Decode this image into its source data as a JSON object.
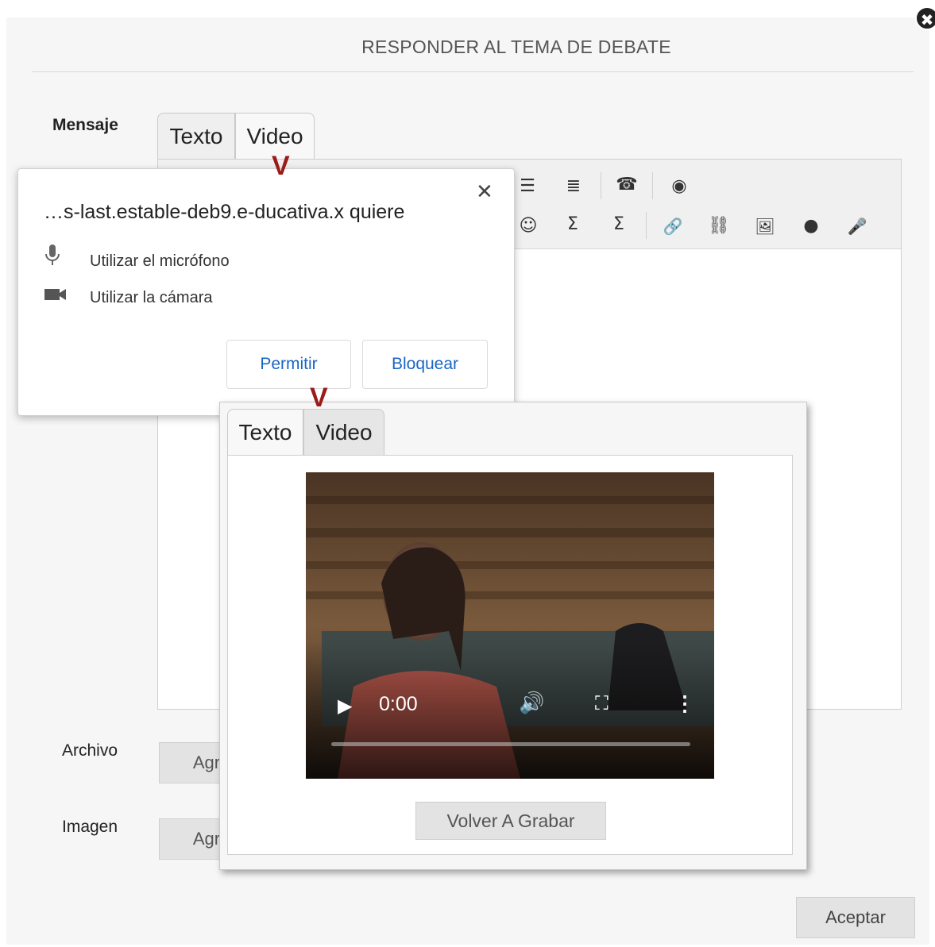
{
  "dialog": {
    "title": "RESPONDER AL TEMA DE DEBATE",
    "close_glyph": "✖",
    "fields": {
      "mensaje_label": "Mensaje",
      "archivo_label": "Archivo",
      "imagen_label": "Imagen"
    },
    "tabs": [
      {
        "label": "Texto"
      },
      {
        "label": "Video"
      }
    ],
    "archivo_button": "Agr",
    "imagen_button": "Agr",
    "accept_button": "Aceptar"
  },
  "toolbar": {
    "row1": [
      {
        "icon": "bulleted-list-icon",
        "glyph": "☰"
      },
      {
        "icon": "numbered-list-icon",
        "glyph": "≣"
      },
      {
        "icon": "speech-icon",
        "glyph": "☎"
      },
      {
        "icon": "preview-eye-icon",
        "glyph": "◉"
      }
    ],
    "row2": [
      {
        "icon": "emoji-icon",
        "glyph": "☺"
      },
      {
        "icon": "sigma-subscript-icon",
        "glyph": "Σ"
      },
      {
        "icon": "sigma-icon",
        "glyph": "Σ"
      },
      {
        "icon": "link-icon",
        "glyph": "🔗"
      },
      {
        "icon": "unlink-icon",
        "glyph": "⛓"
      },
      {
        "icon": "image-icon",
        "glyph": "🖼"
      },
      {
        "icon": "3d-icon",
        "glyph": "●"
      },
      {
        "icon": "microphone-icon",
        "glyph": "🎤"
      }
    ]
  },
  "permission_prompt": {
    "site": "…s-last.estable-deb9.e-ducativa.x quiere",
    "microphone": "Utilizar el micrófono",
    "camera": "Utilizar la cámara",
    "allow": "Permitir",
    "block": "Bloquear",
    "close_glyph": "✕"
  },
  "annotation": {
    "marker": "V"
  },
  "video_panel": {
    "tabs": [
      {
        "label": "Texto"
      },
      {
        "label": "Video"
      }
    ],
    "player": {
      "time": "0:00",
      "progress": 0
    },
    "rerecord_button": "Volver A Grabar"
  },
  "colors": {
    "accent_link": "#1a66c4",
    "annotation_marker": "#9b1b1b",
    "dialog_bg": "#f6f6f6"
  }
}
